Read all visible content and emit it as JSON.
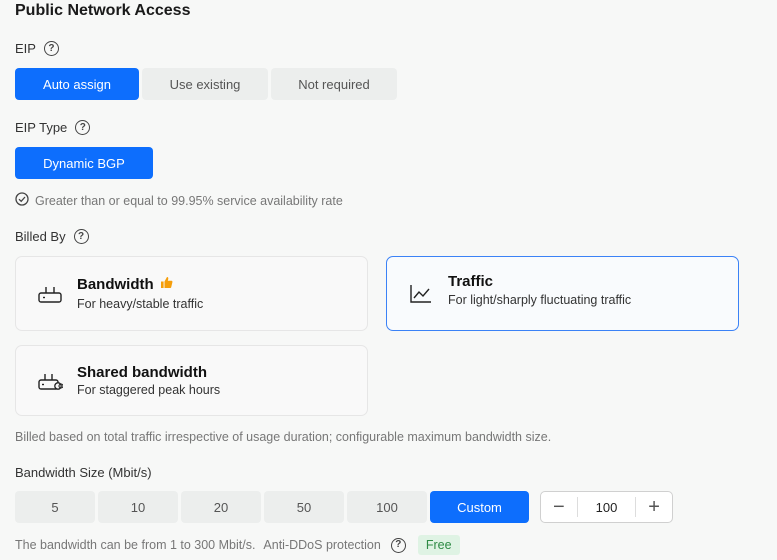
{
  "section_title": "Public Network Access",
  "eip": {
    "label": "EIP",
    "options": [
      "Auto assign",
      "Use existing",
      "Not required"
    ],
    "selected": "Auto assign"
  },
  "eip_type": {
    "label": "EIP Type",
    "options": [
      "Dynamic BGP"
    ],
    "selected": "Dynamic BGP",
    "availability_note": "Greater than or equal to 99.95% service availability rate"
  },
  "billing": {
    "label": "Billed By",
    "cards": [
      {
        "title": "Bandwidth",
        "subtitle": "For heavy/stable traffic",
        "icon": "router-icon",
        "badge": "thumbs-up-icon"
      },
      {
        "title": "Traffic",
        "subtitle": "For light/sharply fluctuating traffic",
        "icon": "line-chart-icon"
      },
      {
        "title": "Shared bandwidth",
        "subtitle": "For staggered peak hours",
        "icon": "shared-router-icon"
      }
    ],
    "selected": "Traffic",
    "description": "Billed based on total traffic irrespective of usage duration; configurable maximum bandwidth size."
  },
  "bandwidth_size": {
    "label": "Bandwidth Size (Mbit/s)",
    "options": [
      "5",
      "10",
      "20",
      "50",
      "100",
      "Custom"
    ],
    "selected": "Custom",
    "stepper": {
      "minus": "−",
      "value": "100",
      "plus": "+"
    },
    "range_note": "The bandwidth can be from 1 to 300 Mbit/s.",
    "ddos_label": "Anti-DDoS protection",
    "ddos_badge": "Free"
  },
  "colors": {
    "accent": "#0d6efd",
    "selected_border": "#3b82f6",
    "free_badge_bg": "#dff3e4",
    "free_badge_text": "#2e8b45",
    "thumbs_up": "#f59e0b"
  }
}
